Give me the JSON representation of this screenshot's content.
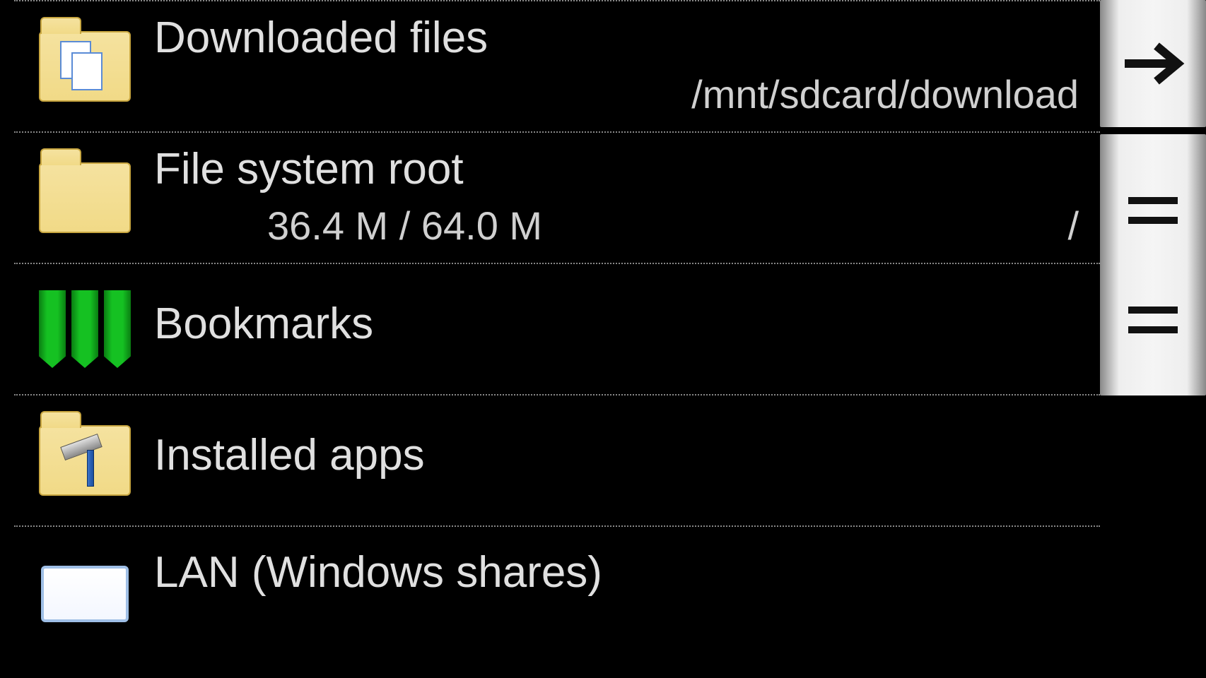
{
  "items": [
    {
      "icon": "folder-docs",
      "title": "Downloaded files",
      "subleft": "",
      "subright": "/mnt/sdcard/download"
    },
    {
      "icon": "folder",
      "title": "File system root",
      "subleft": "36.4 M / 64.0 M",
      "subright": "/"
    },
    {
      "icon": "bookmark",
      "title": "Bookmarks",
      "subleft": "",
      "subright": ""
    },
    {
      "icon": "folder-hammer",
      "title": "Installed apps",
      "subleft": "",
      "subright": ""
    },
    {
      "icon": "lan",
      "title": "LAN (Windows shares)",
      "subleft": "",
      "subright": ""
    }
  ]
}
